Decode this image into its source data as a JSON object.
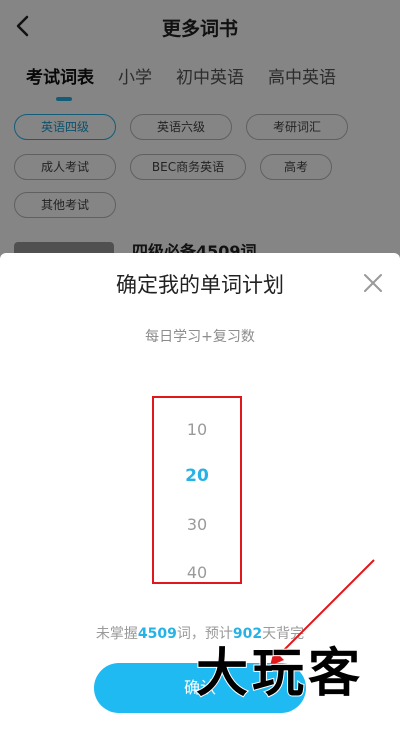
{
  "header": {
    "title": "更多词书"
  },
  "tabs": [
    {
      "label": "考试词表",
      "active": true
    },
    {
      "label": "小学",
      "active": false
    },
    {
      "label": "初中英语",
      "active": false
    },
    {
      "label": "高中英语",
      "active": false
    }
  ],
  "chips": [
    {
      "label": "英语四级",
      "active": true
    },
    {
      "label": "英语六级",
      "active": false
    },
    {
      "label": "考研词汇",
      "active": false
    },
    {
      "label": "成人考试",
      "active": false
    },
    {
      "label": "BEC商务英语",
      "active": false
    },
    {
      "label": "高考",
      "active": false
    },
    {
      "label": "其他考试",
      "active": false
    }
  ],
  "book": {
    "title": "四级必备4509词"
  },
  "sheet": {
    "title": "确定我的单词计划",
    "subtitle": "每日学习+复习数",
    "picker": {
      "options": [
        "10",
        "20",
        "30",
        "40"
      ],
      "selected": "20"
    },
    "estimate": {
      "prefix": "未掌握",
      "words": "4509",
      "middle": "词，预计",
      "days": "902",
      "suffix": "天背完"
    },
    "confirm_label": "确认"
  },
  "watermark": {
    "text": "大玩客"
  },
  "colors": {
    "accent": "#27b2e6",
    "annotation": "#e0181b",
    "button": "#1fbaf1"
  }
}
